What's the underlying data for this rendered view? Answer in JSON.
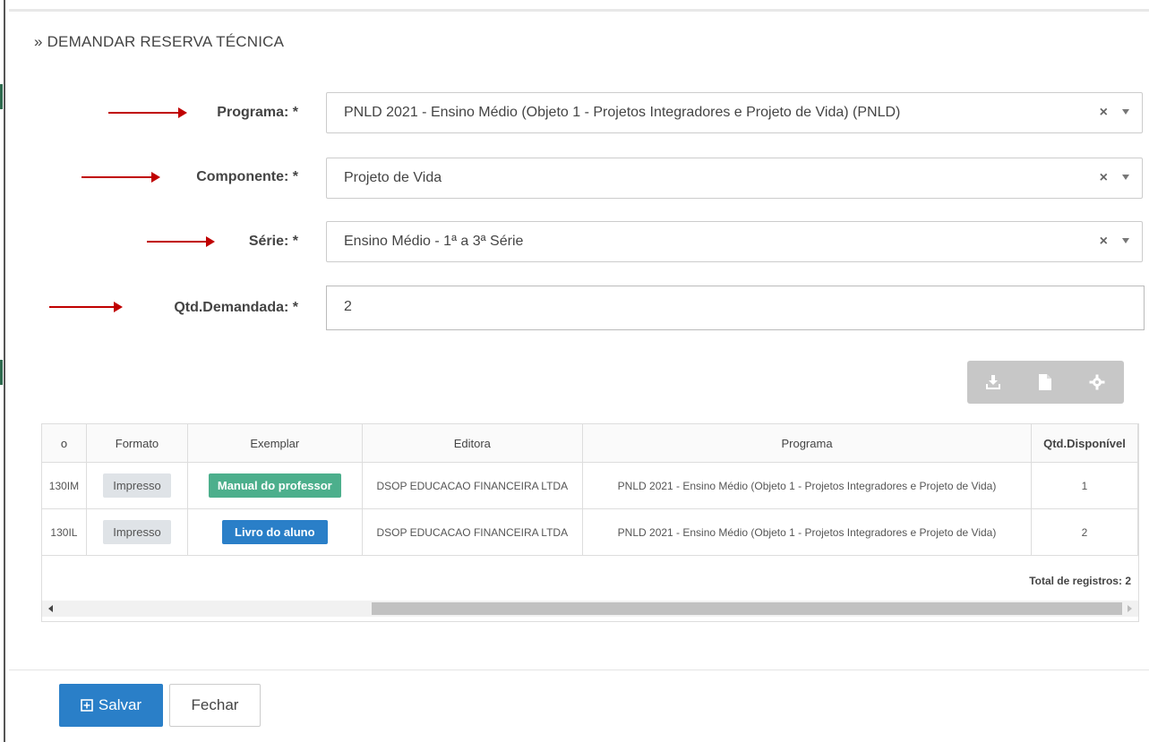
{
  "title": "» DEMANDAR RESERVA TÉCNICA",
  "form": {
    "programa": {
      "label": "Programa: *",
      "value": "PNLD 2021 - Ensino Médio (Objeto 1 - Projetos Integradores e Projeto de Vida) (PNLD)",
      "clear": "×"
    },
    "componente": {
      "label": "Componente: *",
      "value": "Projeto de Vida",
      "clear": "×"
    },
    "serie": {
      "label": "Série: *",
      "value": "Ensino Médio - 1ª a 3ª Série",
      "clear": "×"
    },
    "qtd": {
      "label": "Qtd.Demandada: *",
      "value": "2"
    }
  },
  "toolbar": {
    "icons": [
      "download-icon",
      "file-icon",
      "gear-icon"
    ]
  },
  "grid": {
    "columns": [
      "o",
      "Formato",
      "Exemplar",
      "Editora",
      "Programa",
      "Qtd.Disponível"
    ],
    "rows": [
      {
        "code": "130IM",
        "formato": "Impresso",
        "exemplar": "Manual do professor",
        "editora": "DSOP EDUCACAO FINANCEIRA LTDA",
        "programa": "PNLD 2021 - Ensino Médio (Objeto 1 - Projetos Integradores e Projeto de Vida)",
        "qtd": "1"
      },
      {
        "code": "130IL",
        "formato": "Impresso",
        "exemplar": "Livro do aluno",
        "editora": "DSOP EDUCACAO FINANCEIRA LTDA",
        "programa": "PNLD 2021 - Ensino Médio (Objeto 1 - Projetos Integradores e Projeto de Vida)",
        "qtd": "2"
      }
    ],
    "total": "Total de registros: 2"
  },
  "footer": {
    "save_label": "Salvar",
    "close_label": "Fechar"
  },
  "colors": {
    "primary": "#2a7fc8",
    "success": "#4caf8c",
    "arrow": "#c00000"
  }
}
